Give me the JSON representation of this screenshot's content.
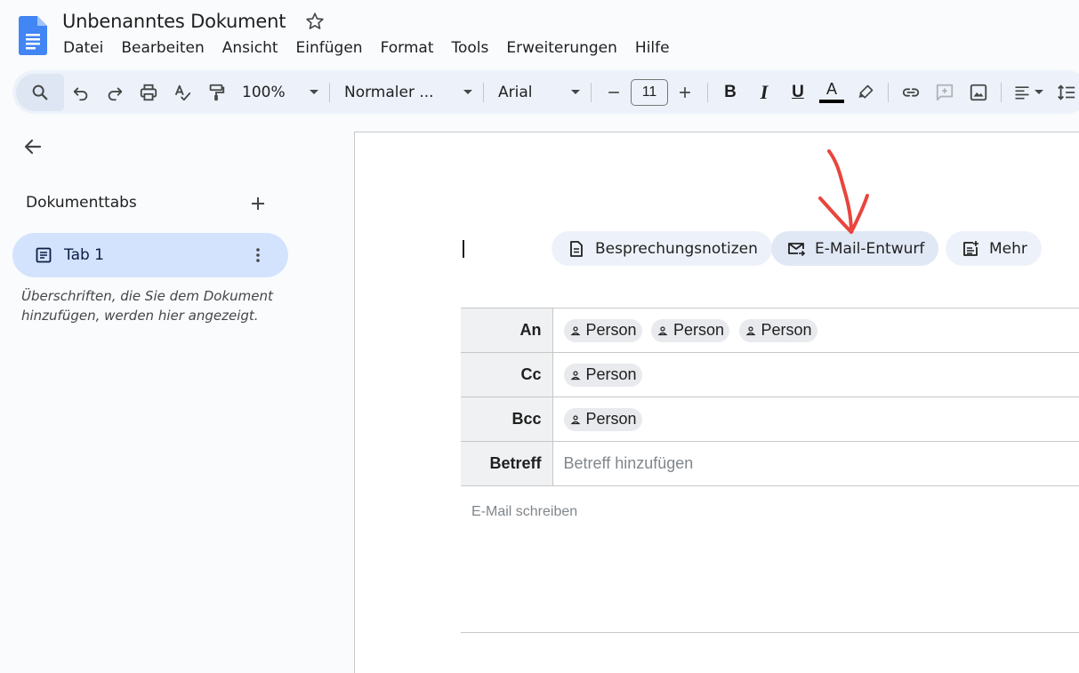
{
  "app": {
    "title": "Unbenanntes Dokument",
    "menu": [
      "Datei",
      "Bearbeiten",
      "Ansicht",
      "Einfügen",
      "Format",
      "Tools",
      "Erweiterungen",
      "Hilfe"
    ]
  },
  "toolbar": {
    "zoom": "100%",
    "style": "Normaler ...",
    "font": "Arial",
    "font_size": "11",
    "bold": "B",
    "italic": "I",
    "underline": "U",
    "text_color_letter": "A",
    "text_color": "#000000"
  },
  "sidebar": {
    "heading": "Dokumenttabs",
    "tabs": [
      {
        "label": "Tab 1"
      }
    ],
    "hint": "Überschriften, die Sie dem Dokument hinzufügen, werden hier angezeigt."
  },
  "chips": {
    "meeting_notes": "Besprechungsnotizen",
    "email_draft": "E-Mail-Entwurf",
    "more": "Mehr"
  },
  "email": {
    "to_label": "An",
    "cc_label": "Cc",
    "bcc_label": "Bcc",
    "subject_label": "Betreff",
    "to": [
      "Person",
      "Person",
      "Person"
    ],
    "cc": [
      "Person"
    ],
    "bcc": [
      "Person"
    ],
    "subject_placeholder": "Betreff hinzufügen",
    "body_placeholder": "E-Mail schreiben"
  },
  "colors": {
    "brand": "#4285f4",
    "annotation": "#e8453c",
    "tab_active": "#d3e3fd",
    "toolbar_bg": "#edf2fa"
  }
}
